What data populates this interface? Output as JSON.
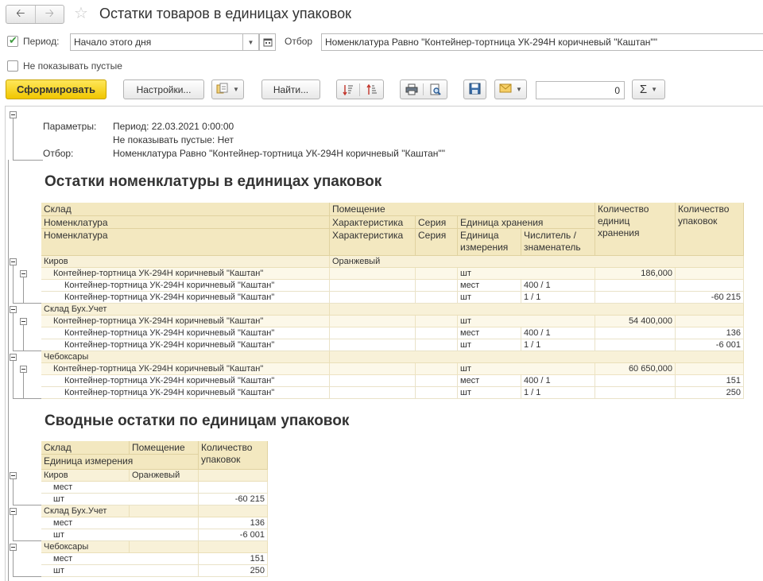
{
  "window": {
    "title": "Остатки товаров в единицах упаковок"
  },
  "filters": {
    "period_label": "Период:",
    "period_value": "Начало этого дня",
    "filter_label": "Отбор",
    "filter_value": "Номенклатура Равно \"Контейнер-тортница УК-294Н коричневый \"Каштан\"\"",
    "hide_empty_label": "Не показывать пустые"
  },
  "toolbar": {
    "generate_label": "Сформировать",
    "settings_label": "Настройки...",
    "find_label": "Найти...",
    "sum_value": "0",
    "sigma_label": "Σ"
  },
  "params": {
    "params_label": "Параметры:",
    "period_line": "Период: 22.03.2021 0:00:00",
    "hide_empty_line": "Не показывать пустые: Нет",
    "filter_label": "Отбор:",
    "filter_line": "Номенклатура Равно \"Контейнер-тортница УК-294Н коричневый \"Каштан\"\""
  },
  "section1": {
    "title": "Остатки номенклатуры в единицах упаковок",
    "headers": {
      "warehouse": "Склад",
      "room": "Помещение",
      "nomenclature": "Номенклатура",
      "characteristic": "Характеристика",
      "series": "Серия",
      "storage_unit": "Единица хранения",
      "unit": "Единица измерения",
      "numerator": "Числитель / знаменатель",
      "qty_storage": "Количество единиц хранения",
      "qty_packs": "Количество упаковок"
    },
    "groups": [
      {
        "warehouse": "Киров",
        "room": "Оранжевый",
        "item": {
          "name": "Контейнер-тортница УК-294Н коричневый \"Каштан\"",
          "unit": "шт",
          "qty": "186,000"
        },
        "details": [
          {
            "name": "Контейнер-тортница УК-294Н коричневый \"Каштан\"",
            "unit": "мест",
            "ratio": "400 / 1",
            "packs": ""
          },
          {
            "name": "Контейнер-тортница УК-294Н коричневый \"Каштан\"",
            "unit": "шт",
            "ratio": "1 / 1",
            "packs": "-60 215"
          }
        ]
      },
      {
        "warehouse": "Склад Бух.Учет",
        "room": "",
        "item": {
          "name": "Контейнер-тортница УК-294Н коричневый \"Каштан\"",
          "unit": "шт",
          "qty": "54 400,000"
        },
        "details": [
          {
            "name": "Контейнер-тортница УК-294Н коричневый \"Каштан\"",
            "unit": "мест",
            "ratio": "400 / 1",
            "packs": "136"
          },
          {
            "name": "Контейнер-тортница УК-294Н коричневый \"Каштан\"",
            "unit": "шт",
            "ratio": "1 / 1",
            "packs": "-6 001"
          }
        ]
      },
      {
        "warehouse": "Чебоксары",
        "room": "",
        "item": {
          "name": "Контейнер-тортница УК-294Н коричневый \"Каштан\"",
          "unit": "шт",
          "qty": "60 650,000"
        },
        "details": [
          {
            "name": "Контейнер-тортница УК-294Н коричневый \"Каштан\"",
            "unit": "мест",
            "ratio": "400 / 1",
            "packs": "151"
          },
          {
            "name": "Контейнер-тортница УК-294Н коричневый \"Каштан\"",
            "unit": "шт",
            "ratio": "1 / 1",
            "packs": "250"
          }
        ]
      }
    ]
  },
  "section2": {
    "title": "Сводные остатки по единицам упаковок",
    "headers": {
      "warehouse": "Склад",
      "room": "Помещение",
      "unit": "Единица измерения",
      "qty_packs": "Количество упаковок"
    },
    "groups": [
      {
        "warehouse": "Киров",
        "room": "Оранжевый",
        "rows": [
          {
            "unit": "мест",
            "packs": ""
          },
          {
            "unit": "шт",
            "packs": "-60 215"
          }
        ]
      },
      {
        "warehouse": "Склад Бух.Учет",
        "room": "",
        "rows": [
          {
            "unit": "мест",
            "packs": "136"
          },
          {
            "unit": "шт",
            "packs": "-6 001"
          }
        ]
      },
      {
        "warehouse": "Чебоксары",
        "room": "",
        "rows": [
          {
            "unit": "мест",
            "packs": "151"
          },
          {
            "unit": "шт",
            "packs": "250"
          }
        ]
      }
    ]
  },
  "icons": [
    "back-arrow-icon",
    "forward-arrow-icon",
    "favorite-star-icon",
    "calendar-icon",
    "variants-icon",
    "sort-ascending-icon",
    "sort-descending-icon",
    "print-icon",
    "print-preview-icon",
    "save-icon",
    "mail-icon"
  ]
}
